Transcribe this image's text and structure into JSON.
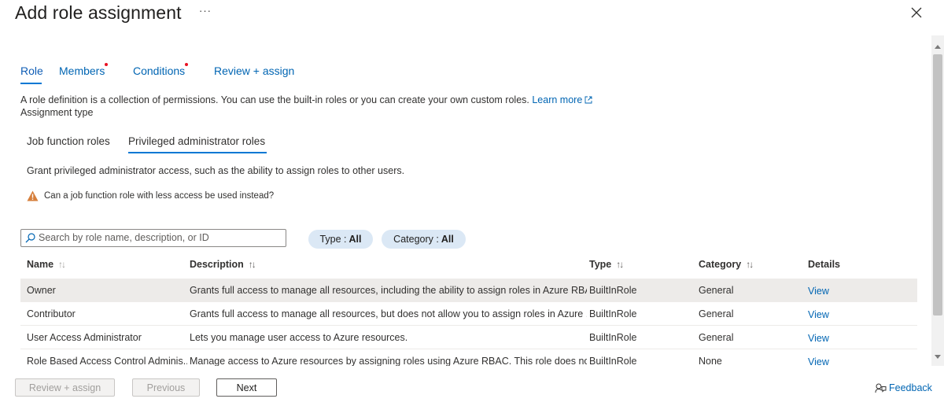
{
  "header": {
    "title": "Add role assignment",
    "more_label": "···",
    "close_icon": "close-icon"
  },
  "tabs": [
    {
      "label": "Role",
      "active": true,
      "required_dot": false
    },
    {
      "label": "Members",
      "active": false,
      "required_dot": true
    },
    {
      "label": "Conditions",
      "active": false,
      "required_dot": true
    },
    {
      "label": "Review + assign",
      "active": false,
      "required_dot": false
    }
  ],
  "intro": {
    "text": "A role definition is a collection of permissions. You can use the built-in roles or you can create your own custom roles.",
    "learn_more": "Learn more",
    "assignment_type": "Assignment type"
  },
  "role_tabs": [
    {
      "label": "Job function roles",
      "active": false
    },
    {
      "label": "Privileged administrator roles",
      "active": true
    }
  ],
  "privileged": {
    "description": "Grant privileged administrator access, such as the ability to assign roles to other users.",
    "warning": "Can a job function role with less access be used instead?"
  },
  "search": {
    "placeholder": "Search by role name, description, or ID",
    "value": ""
  },
  "filters": [
    {
      "label": "Type :",
      "value": "All"
    },
    {
      "label": "Category :",
      "value": "All"
    }
  ],
  "table": {
    "columns": [
      "Name",
      "Description",
      "Type",
      "Category",
      "Details"
    ],
    "rows": [
      {
        "name": "Owner",
        "description": "Grants full access to manage all resources, including the ability to assign roles in Azure RBAC.",
        "type": "BuiltInRole",
        "category": "General",
        "details": "View"
      },
      {
        "name": "Contributor",
        "description": "Grants full access to manage all resources, but does not allow you to assign roles in Azure ...",
        "type": "BuiltInRole",
        "category": "General",
        "details": "View"
      },
      {
        "name": "User Access Administrator",
        "description": "Lets you manage user access to Azure resources.",
        "type": "BuiltInRole",
        "category": "General",
        "details": "View"
      },
      {
        "name": "Role Based Access Control Adminis...",
        "description": "Manage access to Azure resources by assigning roles using Azure RBAC. This role does not ...",
        "type": "BuiltInRole",
        "category": "None",
        "details": "View"
      }
    ]
  },
  "footer": {
    "review_assign": "Review + assign",
    "previous": "Previous",
    "next": "Next",
    "feedback": "Feedback"
  },
  "colors": {
    "link": "#0065b3",
    "accent": "#0078d4",
    "required_dot": "#e81123",
    "warning": "#d67f3c",
    "selected_row": "#edebe9",
    "filter_pill": "#dbe8f5"
  }
}
